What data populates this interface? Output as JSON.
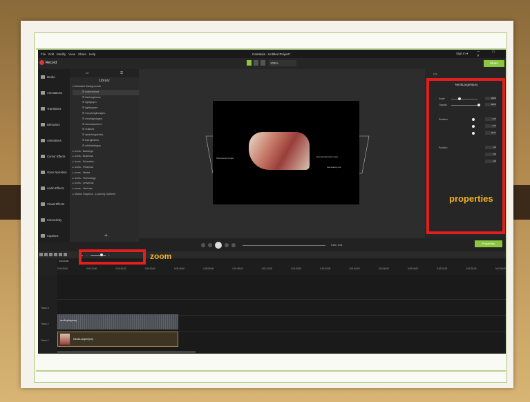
{
  "app": {
    "title": "Camtasia - Untitled Project*",
    "menu": [
      "File",
      "Edit",
      "Modify",
      "View",
      "Share",
      "Help"
    ],
    "sign_in": "Sign in ▾",
    "window_controls": "— ▢ ✕",
    "record_label": "Record",
    "zoom_level": "109%",
    "share_label": "Share"
  },
  "tools_sidebar": {
    "items": [
      {
        "label": "Media",
        "icon": "media-icon"
      },
      {
        "label": "Annotations",
        "icon": "annotations-icon"
      },
      {
        "label": "Transitions",
        "icon": "transitions-icon"
      },
      {
        "label": "Behaviors",
        "icon": "behaviors-icon"
      },
      {
        "label": "Animations",
        "icon": "animations-icon"
      },
      {
        "label": "Cursor Effects",
        "icon": "cursor-icon"
      },
      {
        "label": "Voice Narration",
        "icon": "microphone-icon"
      },
      {
        "label": "Audio Effects",
        "icon": "speaker-icon"
      },
      {
        "label": "Visual Effects",
        "icon": "wand-icon"
      },
      {
        "label": "Interactivity",
        "icon": "interactivity-icon"
      },
      {
        "label": "Captions",
        "icon": "cc-icon"
      }
    ]
  },
  "library": {
    "title": "Library",
    "items": [
      {
        "label": "▾ Animated Backgrounds",
        "level": 0
      },
      {
        "label": "☰ bokehvelvet",
        "level": 1,
        "selected": true
      },
      {
        "label": "☰ flashingboxes",
        "level": 1
      },
      {
        "label": "☰ lightgraph",
        "level": 1
      },
      {
        "label": "☰ lightsquare",
        "level": 1
      },
      {
        "label": "☰ morphinglinesgiro",
        "level": 1
      },
      {
        "label": "☰ movingpolygon",
        "level": 1
      },
      {
        "label": "☰ neonwaveform",
        "level": 1
      },
      {
        "label": "☰ redlines",
        "level": 1
      },
      {
        "label": "☰ splashingcircles",
        "level": 1
      },
      {
        "label": "☰ triangleslms",
        "level": 1
      },
      {
        "label": "☰ whitedotlogos",
        "level": 1
      },
      {
        "label": "▸ Icons - Buildings",
        "level": 0
      },
      {
        "label": "▸ Icons - Business",
        "level": 0
      },
      {
        "label": "▸ Icons - Education",
        "level": 0
      },
      {
        "label": "▸ Icons - Financial",
        "level": 0
      },
      {
        "label": "▸ Icons - Media",
        "level": 0
      },
      {
        "label": "▸ Icons - Technology",
        "level": 0
      },
      {
        "label": "▸ Icons - Universal",
        "level": 0
      },
      {
        "label": "▸ Icons - Vehicles",
        "level": 0
      },
      {
        "label": "▸ Motion Graphics - Learning Outlines",
        "level": 0
      }
    ]
  },
  "canvas": {
    "left_label": "Subcutaneous fat layer",
    "right_label": "Sternocleidomastoid muscle",
    "right_sub": "www.anatomy.com"
  },
  "playback": {
    "time": "0:00 / 0:01"
  },
  "properties": {
    "clip_name": "NeckLargeInjury",
    "scale_label": "Scale",
    "scale_value": "100%",
    "opacity_label": "Opacity",
    "opacity_value": "100%",
    "rotation_label": "Rotation",
    "rotation_z": "0.0°",
    "rotation_y": "0.0°",
    "rotation_x": "90.0°",
    "position_label": "Position",
    "position_x": "0.0",
    "position_y": "0.0",
    "position_z": "0.0",
    "button_label": "Properties"
  },
  "annotations": {
    "properties_callout": "properties",
    "zoom_callout": "zoom"
  },
  "timeline": {
    "playhead": "0:00:00;00",
    "ruler": [
      "0:00:00;00",
      "0:00:10;00",
      "0:00:20;00",
      "0:00:30;00",
      "0:00:40;00",
      "0:00:50;00",
      "0:01:00;00",
      "0:01:10;00",
      "0:01:20;00",
      "0:01:30;00",
      "0:01:40;00",
      "0:01:50;00",
      "0:02:00;00",
      "0:02:10;00",
      "0:02:20;00",
      "0:02:30;00"
    ],
    "tracks": [
      "Track 3",
      "Track 2",
      "Track 1"
    ],
    "audio_clip": "audioplayway",
    "video_clip": "NeckLargeInjury"
  },
  "colors": {
    "accent": "#8cc63f",
    "callout_border": "#e21f1f",
    "callout_text": "#f2b21d"
  }
}
